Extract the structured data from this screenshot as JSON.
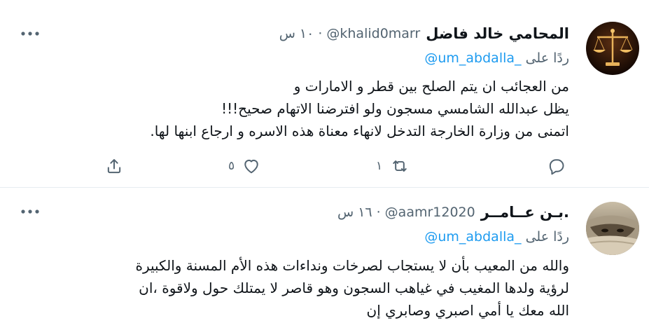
{
  "tweets": [
    {
      "name": "المحامي خالد فاضل",
      "handle": "@khalid0marr",
      "dot": "·",
      "time": "١٠ س",
      "reply_prefix": "ردًا على",
      "reply_to": "@um_abdalla_",
      "lines": [
        "من العجائب ان يتم الصلح بين قطر و الامارات و",
        "يظل عبدالله الشامسي مسجون ولو افترضنا الاتهام صحيح!!!",
        "اتمنى من وزارة الخارجة التدخل لانهاء معناة هذه الاسره و ارجاع ابنها لها."
      ],
      "retweet_count": "١",
      "like_count": "٥"
    },
    {
      "name": "بـن عــامــر.",
      "handle": "@aamr12020",
      "dot": "·",
      "time": "١٦ س",
      "reply_prefix": "ردًا على",
      "reply_to": "@um_abdalla_",
      "lines": [
        "والله من المعيب بأن لا يستجاب لصرخات ونداءات هذه الأم المسنة والكبيرة",
        "لرؤية ولدها المغيب في غياهب السجون وهو قاصر لا يمتلك حول ولاقوة ،ان",
        "الله معك يا أمي اصبري وصابري إن"
      ]
    }
  ],
  "colors": {
    "text": "#0f1419",
    "secondary": "#536471",
    "link": "#1d9bf0",
    "divider": "#e6ecf0"
  },
  "icons": [
    "more-icon",
    "reply-icon",
    "retweet-icon",
    "like-icon",
    "share-icon"
  ]
}
